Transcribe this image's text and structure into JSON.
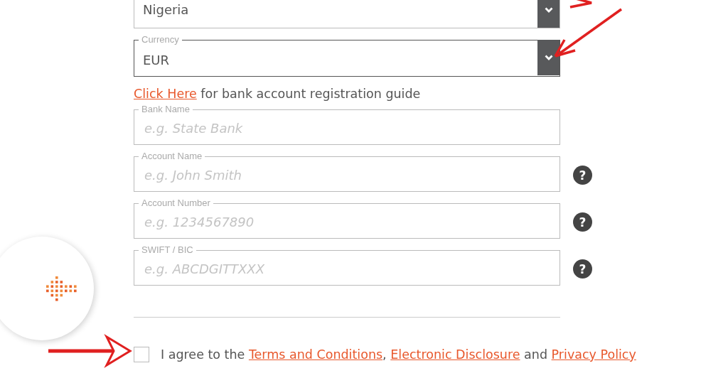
{
  "country": {
    "value": "Nigeria"
  },
  "currency": {
    "label": "Currency",
    "value": "EUR",
    "focused": true
  },
  "guide": {
    "link": "Click Here",
    "text": " for bank account registration guide"
  },
  "fields": [
    {
      "label": "Bank Name",
      "placeholder": "e.g. State Bank"
    },
    {
      "label": "Account Name",
      "placeholder": "e.g. John Smith",
      "help": "?"
    },
    {
      "label": "Account Number",
      "placeholder": "e.g. 1234567890",
      "help": "?"
    },
    {
      "label": "SWIFT / BIC",
      "placeholder": "e.g. ABCDGITTXXX",
      "help": "?"
    }
  ],
  "agreement": {
    "checked": false,
    "parts": [
      {
        "kind": "text",
        "text": "I agree to the "
      },
      {
        "kind": "link",
        "text": "Terms and Conditions"
      },
      {
        "kind": "text",
        "text": ", "
      },
      {
        "kind": "link",
        "text": "Electronic Disclosure"
      },
      {
        "kind": "text",
        "text": " and "
      },
      {
        "kind": "link",
        "text": "Privacy Policy"
      }
    ]
  }
}
